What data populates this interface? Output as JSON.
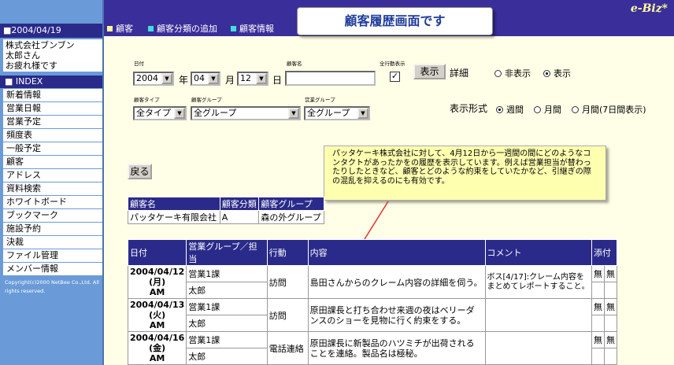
{
  "sidebar": {
    "date": "■2004/04/19",
    "greeting": [
      "株式会社ブンブン",
      "太郎さん",
      "お疲れ様です"
    ],
    "index_label": "■ INDEX",
    "menu": [
      "新着情報",
      "営業日報",
      "営業予定",
      "頻度表",
      "一般予定",
      "顧客",
      "アドレス",
      "資料検索",
      "ホワイトボード",
      "ブックマーク",
      "施設予約",
      "決裁",
      "ファイル管理",
      "メンバー情報"
    ],
    "copyright": "Copyright(c)2000 NetBee Co.,Ltd. All rights reserved."
  },
  "header": {
    "brand": "e-Biz*",
    "nav": [
      "顧客",
      "顧客分類の追加",
      "顧客情報"
    ],
    "callout": "顧客履歴画面です"
  },
  "form": {
    "date_label": "日付",
    "customer_name_label": "顧客名",
    "show_all_label": "全行動表示",
    "year": "2004",
    "year_unit": "年",
    "month": "04",
    "month_unit": "月",
    "day": "12",
    "day_unit": "日",
    "customer_name_value": "",
    "display_button": "表示",
    "detail_label": "詳細",
    "hide_option": "非表示",
    "show_option": "表示",
    "show_all_checked": "✓",
    "customer_type_label": "顧客タイプ",
    "customer_group_label": "顧客グループ",
    "sales_group_label": "営業グループ",
    "customer_type": "全タイプ",
    "customer_group": "全グループ",
    "sales_group": "全グループ",
    "display_format_label": "表示形式",
    "format_options": [
      "週間",
      "月間",
      "月間(7日間表示)"
    ],
    "back_button": "戻る"
  },
  "note": "パッタケーキ株式会社に対して、4月12日から一週間の間にどのようなコンタクトがあったかをの履歴を表示しています。例えば営業担当が替わったりしたときなど、顧客とどのような約束をしていたかなど、引継ぎの際の混乱を抑えるのにも有効です。",
  "customer_table": {
    "headers": [
      "顧客名",
      "顧客分類",
      "顧客グループ"
    ],
    "row": [
      "パッタケーキ有限会社",
      "A",
      "森の外グループ"
    ]
  },
  "history_table": {
    "headers": [
      "日付",
      "営業グループ／担当",
      "行動",
      "内容",
      "コメント",
      "添付"
    ],
    "rows": [
      {
        "date": "2004/04/12",
        "weekday": "(月)",
        "period": "AM",
        "group": "営業1課",
        "person": "太郎",
        "action": "訪問",
        "content": "島田さんからのクレーム内容の詳細を伺う。",
        "comment": "ボス[4/17]:クレーム内容をまとめてレポートすること。",
        "attach1": "無",
        "attach2": "無"
      },
      {
        "date": "2004/04/13",
        "weekday": "(火)",
        "period": "AM",
        "group": "営業1課",
        "person": "太郎",
        "action": "訪問",
        "content": "原田課長と打ち合わせ来週の夜はベリーダンスのショーを見物に行く約束をする。",
        "comment": "",
        "attach1": "無",
        "attach2": "無"
      },
      {
        "date": "2004/04/16",
        "weekday": "(金)",
        "period": "AM",
        "group": "営業1課",
        "person": "太郎",
        "action": "電話連絡",
        "content": "原田課長に新製品のハツミチが出荷されることを連絡。製品名は極秘。",
        "comment": "",
        "attach1": "無",
        "attach2": "無"
      }
    ]
  },
  "colors": {
    "header_bg": "#3a2e9a",
    "sidebar_bg": "#6a9bd8",
    "table_head": "#2a2a8a",
    "note_bg": "#ffffb0",
    "page_bg": "#ffffe8"
  }
}
